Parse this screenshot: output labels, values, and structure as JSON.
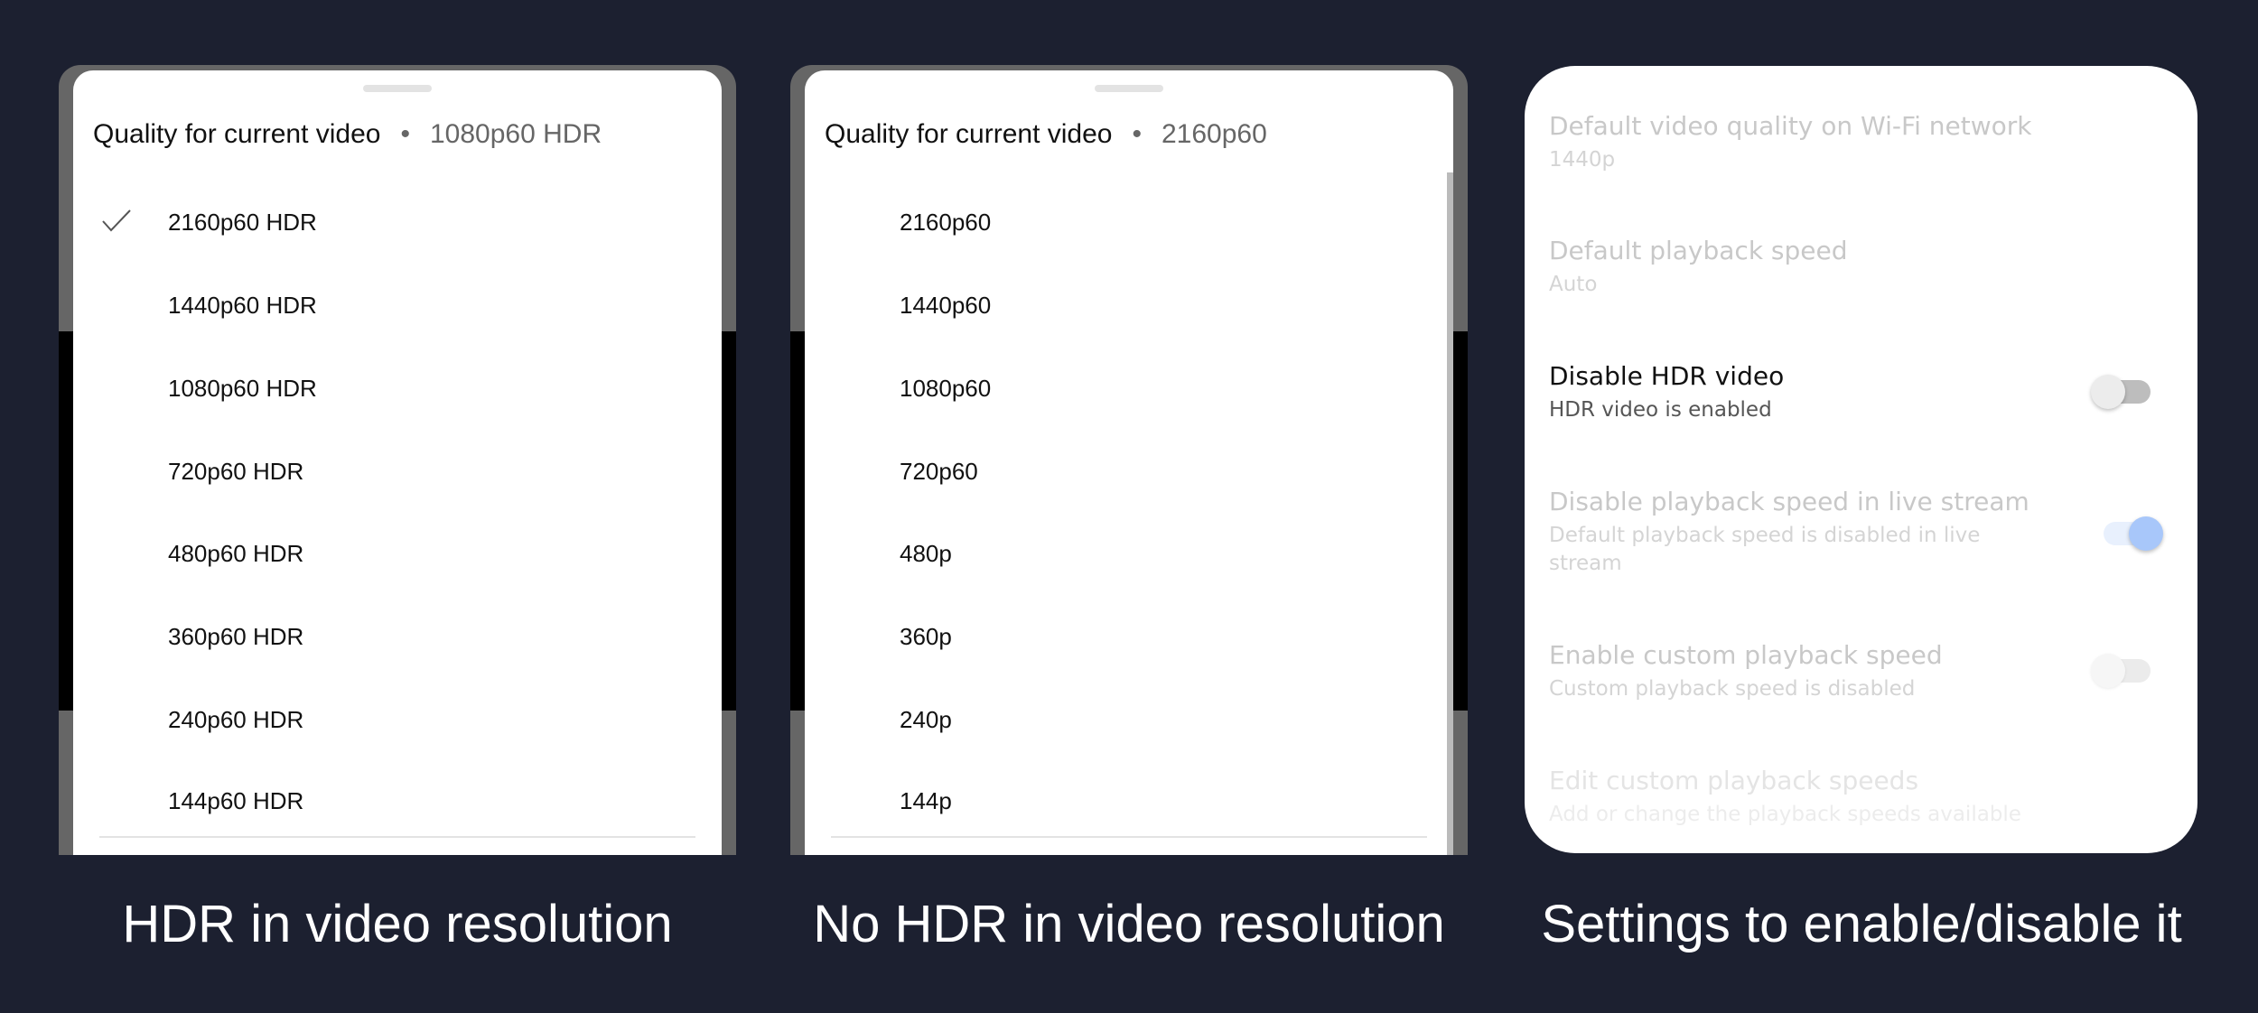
{
  "panels": [
    {
      "header": "Quality for current video",
      "separator": "•",
      "current": "1080p60 HDR",
      "items": [
        "2160p60 HDR",
        "1440p60 HDR",
        "1080p60 HDR",
        "720p60 HDR",
        "480p60 HDR",
        "360p60 HDR",
        "240p60 HDR",
        "144p60 HDR"
      ],
      "checked_index": 0,
      "caption": "HDR in video resolution"
    },
    {
      "header": "Quality for current video",
      "separator": "•",
      "current": "2160p60",
      "items": [
        "2160p60",
        "1440p60",
        "1080p60",
        "720p60",
        "480p",
        "360p",
        "240p",
        "144p"
      ],
      "caption": "No HDR in video resolution"
    }
  ],
  "settings": {
    "rows": [
      {
        "title": "Default video quality on Wi-Fi network",
        "subtitle": "1440p"
      },
      {
        "title": "Default playback speed",
        "subtitle": "Auto"
      },
      {
        "title": "Disable HDR video",
        "subtitle": "HDR video is enabled",
        "toggle": false
      },
      {
        "title": "Disable playback speed in live stream",
        "subtitle": "Default playback speed is disabled in live stream",
        "toggle": true
      },
      {
        "title": "Enable custom playback speed",
        "subtitle": "Custom playback speed is disabled",
        "toggle": false
      },
      {
        "title": "Edit custom playback speeds",
        "subtitle": "Add or change the playback speeds available"
      }
    ],
    "caption": "Settings to enable/disable it",
    "accent": "#a8c7fa"
  }
}
